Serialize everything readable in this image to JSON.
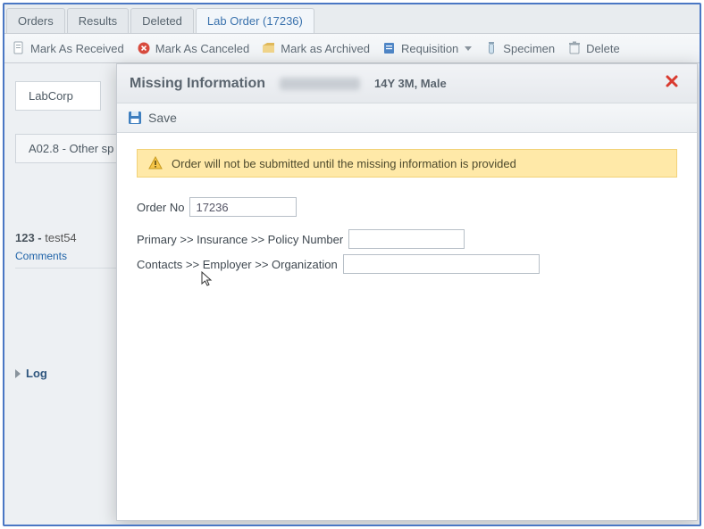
{
  "tabs": {
    "orders": "Orders",
    "results": "Results",
    "deleted": "Deleted",
    "lab_order": "Lab Order (17236)"
  },
  "toolbar": {
    "mark_received": "Mark As Received",
    "mark_canceled": "Mark As Canceled",
    "mark_archived": "Mark as Archived",
    "requisition": "Requisition",
    "specimen": "Specimen",
    "delete": "Delete"
  },
  "background": {
    "lab": "LabCorp",
    "diagnosis": "A02.8 - Other sp",
    "code_prefix": "123 - ",
    "code_suffix": "test54",
    "comments": "Comments",
    "log": "Log"
  },
  "modal": {
    "title": "Missing Information",
    "patient_meta": "14Y 3M, Male",
    "save_label": "Save",
    "warning": "Order will not be submitted until the missing information is provided",
    "order_no_label": "Order No",
    "order_no_value": "17236",
    "policy_label": "Primary >> Insurance >> Policy Number",
    "org_label": "Contacts >> Employer >> Organization"
  }
}
